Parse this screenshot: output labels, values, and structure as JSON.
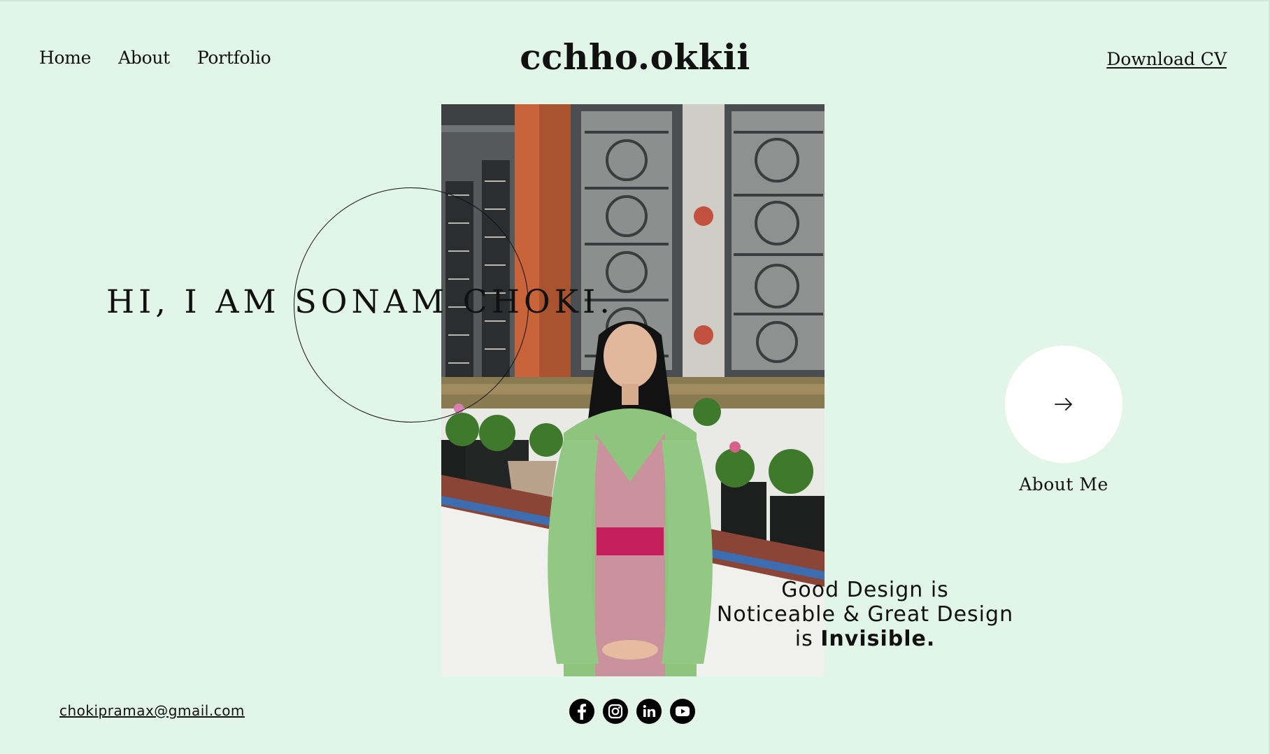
{
  "nav": {
    "items": [
      {
        "label": "Home"
      },
      {
        "label": "About"
      },
      {
        "label": "Portfolio"
      }
    ]
  },
  "logo": {
    "text": "cchho.okkii"
  },
  "header": {
    "download_cv_label": "Download CV"
  },
  "hero": {
    "greeting": "HI, I AM SONAM CHOKI.",
    "photo_icon": "portrait-photo",
    "about_button_icon": "arrow-right-icon",
    "about_label": "About Me"
  },
  "quote": {
    "line1": "Good Design is",
    "line2": "Noticeable & Great Design",
    "line3_prefix": "is ",
    "line3_bold": "Invisible."
  },
  "footer": {
    "email": "chokipramax@gmail.com",
    "socials": [
      {
        "icon": "facebook-icon"
      },
      {
        "icon": "instagram-icon"
      },
      {
        "icon": "linkedin-icon"
      },
      {
        "icon": "youtube-icon"
      }
    ]
  },
  "colors": {
    "background": "#e2f5e9",
    "text": "#111111",
    "button_bg": "#ffffff"
  }
}
